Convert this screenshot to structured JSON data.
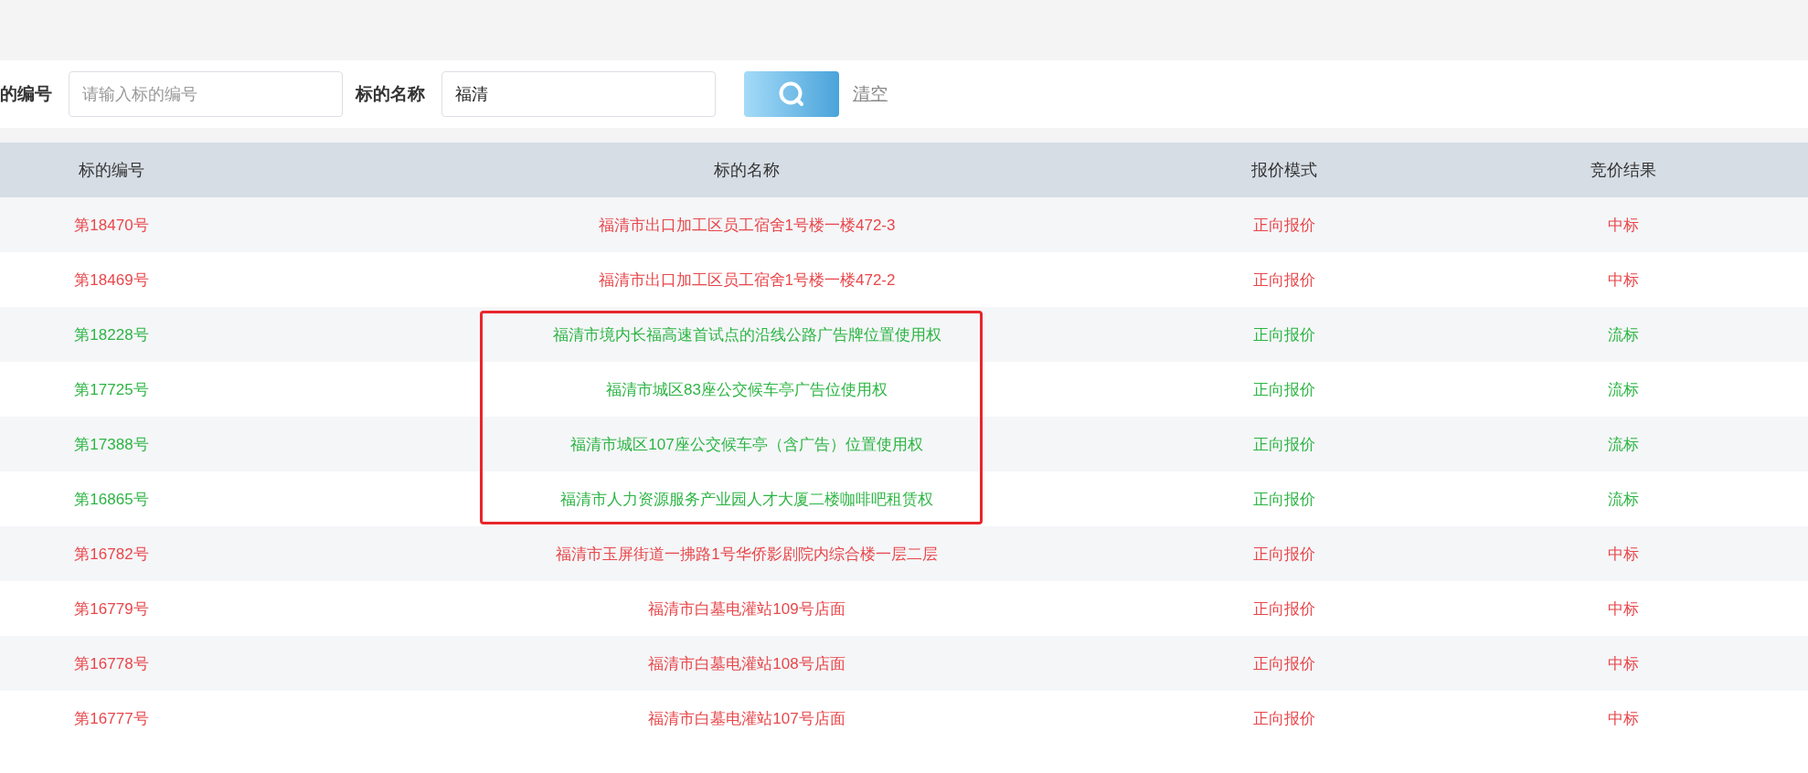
{
  "search": {
    "fields": [
      {
        "label": "的编号",
        "placeholder": "请输入标的编号"
      },
      {
        "label": "标的名称",
        "value": "福清"
      }
    ],
    "clear_link": "清空"
  },
  "table": {
    "columns": [
      "标的编号",
      "标的名称",
      "报价模式",
      "竞价结果"
    ],
    "rows": [
      {
        "number": "第18470号",
        "name": "福清市出口加工区员工宿舍1号楼一楼472-3",
        "mode": "正向报价",
        "result": "中标",
        "color": "#e8464a",
        "highlighted": false
      },
      {
        "number": "第18469号",
        "name": "福清市出口加工区员工宿舍1号楼一楼472-2",
        "mode": "正向报价",
        "result": "中标",
        "color": "#e8464a",
        "highlighted": false
      },
      {
        "number": "第18228号",
        "name": "福清市境内长福高速首试点的沿线公路广告牌位置使用权",
        "mode": "正向报价",
        "result": "流标",
        "color": "#2cb544",
        "highlighted": true
      },
      {
        "number": "第17725号",
        "name": "福清市城区83座公交候车亭广告位使用权",
        "mode": "正向报价",
        "result": "流标",
        "color": "#2cb544",
        "highlighted": true
      },
      {
        "number": "第17388号",
        "name": "福清市城区107座公交候车亭（含广告）位置使用权",
        "mode": "正向报价",
        "result": "流标",
        "color": "#2cb544",
        "highlighted": true
      },
      {
        "number": "第16865号",
        "name": "福清市人力资源服务产业园人才大厦二楼咖啡吧租赁权",
        "mode": "正向报价",
        "result": "流标",
        "color": "#2cb544",
        "highlighted": true
      },
      {
        "number": "第16782号",
        "name": "福清市玉屏街道一拂路1号华侨影剧院内综合楼一层二层",
        "mode": "正向报价",
        "result": "中标",
        "color": "#e8464a",
        "highlighted": false
      },
      {
        "number": "第16779号",
        "name": "福清市白墓电灌站109号店面",
        "mode": "正向报价",
        "result": "中标",
        "color": "#e8464a",
        "highlighted": false
      },
      {
        "number": "第16778号",
        "name": "福清市白墓电灌站108号店面",
        "mode": "正向报价",
        "result": "中标",
        "color": "#e8464a",
        "highlighted": false
      },
      {
        "number": "第16777号",
        "name": "福清市白墓电灌站107号店面",
        "mode": "正向报价",
        "result": "中标",
        "color": "#e8464a",
        "highlighted": false
      }
    ]
  }
}
